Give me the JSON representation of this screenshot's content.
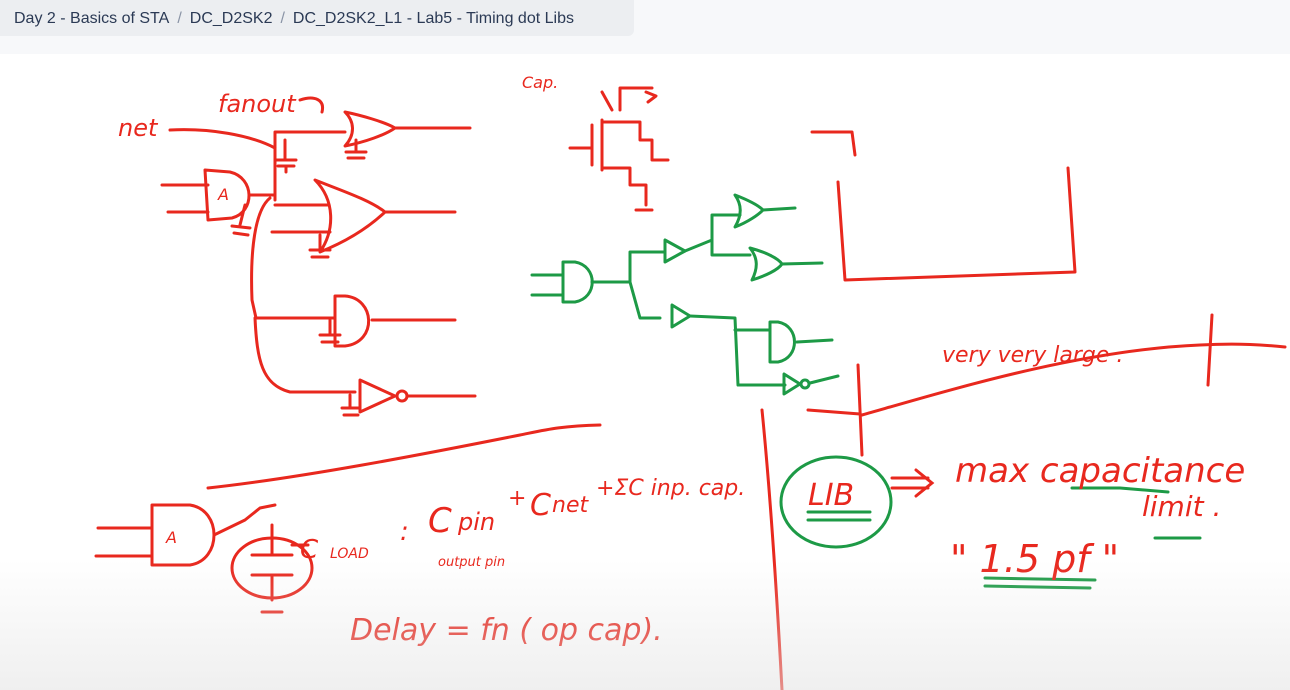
{
  "breadcrumb": {
    "items": [
      {
        "label": "Day 2 - Basics of STA"
      },
      {
        "label": "DC_D2SK2"
      },
      {
        "label": "DC_D2SK2_L1 - Lab5 - Timing dot Libs"
      }
    ],
    "separator": "/"
  },
  "whiteboard": {
    "net": "net",
    "fanout": "fanout",
    "gate_A_1": "A",
    "gate_A_2": "A",
    "cap": "Cap.",
    "very_large": "very very large .",
    "lib": "LIB",
    "max_capacitance": "max capacitance",
    "limit": "limit .",
    "value": "\" 1.5 pf \"",
    "c_load": "C",
    "load_sub": "LOAD",
    "eq_sign": ":",
    "c_pin": "C",
    "pin_sub": "pin",
    "output_pin": "output pin",
    "plus1": "+",
    "c_net": "C",
    "net_sub": "net",
    "sum_cap": "+ΣC inp. cap.",
    "delay": "Delay = fn ( op cap)."
  },
  "colors": {
    "red": "#e8281e",
    "green": "#1d9a46",
    "breadcrumb_text": "#2b3a55"
  }
}
